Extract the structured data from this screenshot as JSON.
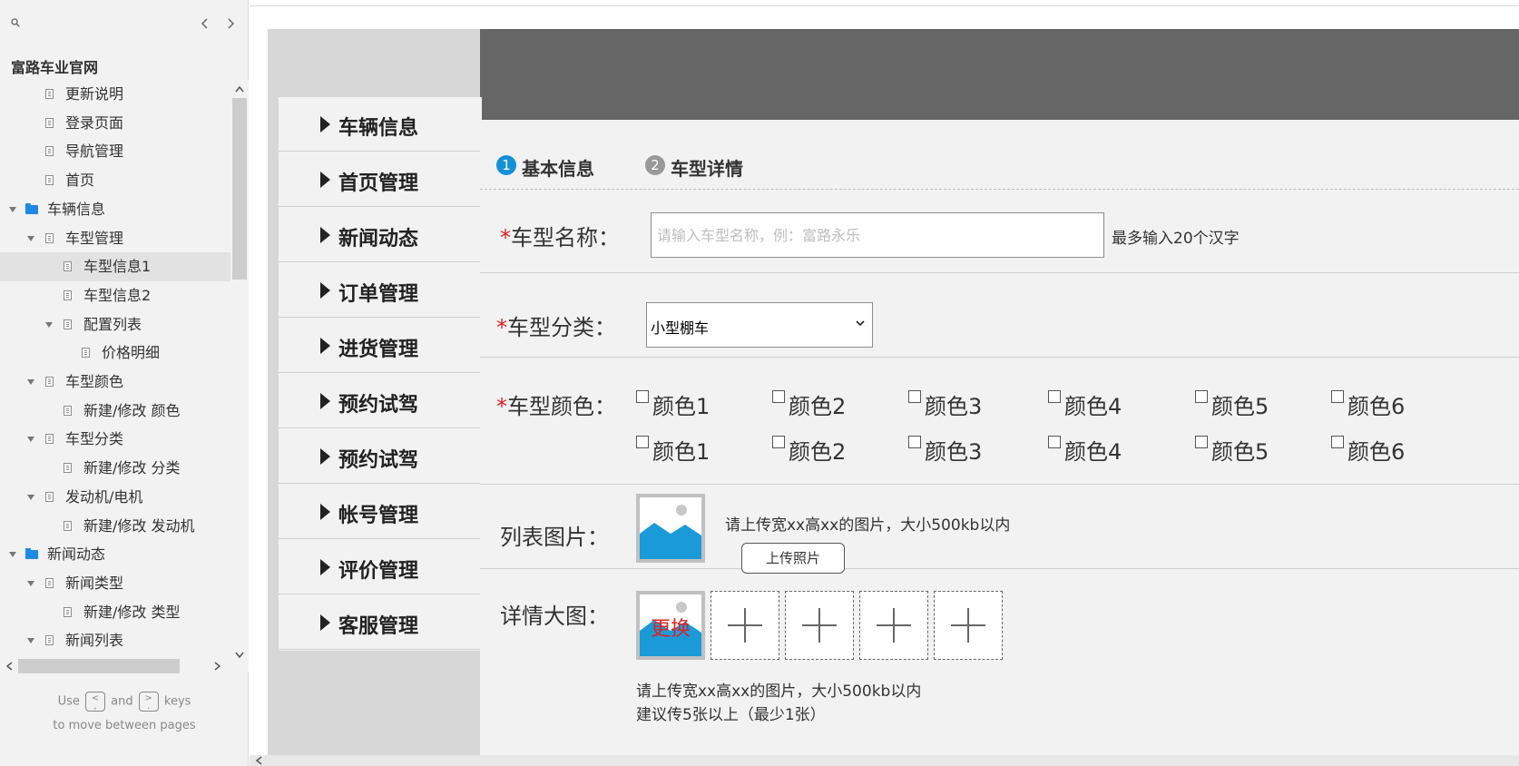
{
  "sidebar": {
    "project_title": "富路车业官网",
    "items": [
      {
        "label": "更新说明",
        "level": 1,
        "type": "page"
      },
      {
        "label": "登录页面",
        "level": 1,
        "type": "page"
      },
      {
        "label": "导航管理",
        "level": 1,
        "type": "page"
      },
      {
        "label": "首页",
        "level": 1,
        "type": "page"
      },
      {
        "label": "车辆信息",
        "level": 0,
        "type": "folder"
      },
      {
        "label": "车型管理",
        "level": 1,
        "type": "page-parent"
      },
      {
        "label": "车型信息1",
        "level": 2,
        "type": "page",
        "selected": true
      },
      {
        "label": "车型信息2",
        "level": 2,
        "type": "page"
      },
      {
        "label": "配置列表",
        "level": 2,
        "type": "page-parent"
      },
      {
        "label": "价格明细",
        "level": 3,
        "type": "page"
      },
      {
        "label": "车型颜色",
        "level": 1,
        "type": "page-parent"
      },
      {
        "label": "新建/修改 颜色",
        "level": 2,
        "type": "page"
      },
      {
        "label": "车型分类",
        "level": 1,
        "type": "page-parent"
      },
      {
        "label": "新建/修改 分类",
        "level": 2,
        "type": "page"
      },
      {
        "label": "发动机/电机",
        "level": 1,
        "type": "page-parent"
      },
      {
        "label": "新建/修改 发动机",
        "level": 2,
        "type": "page"
      },
      {
        "label": "新闻动态",
        "level": 0,
        "type": "folder"
      },
      {
        "label": "新闻类型",
        "level": 1,
        "type": "page-parent"
      },
      {
        "label": "新建/修改 类型",
        "level": 2,
        "type": "page"
      },
      {
        "label": "新闻列表",
        "level": 1,
        "type": "page-parent"
      }
    ],
    "hint": {
      "use": "Use",
      "key_prev": "<\n,",
      "and": "and",
      "key_next": ">\n.",
      "keys": "keys",
      "line2": "to move between pages"
    }
  },
  "menu": {
    "items": [
      "车辆信息",
      "首页管理",
      "新闻动态",
      "订单管理",
      "进货管理",
      "预约试驾",
      "预约试驾",
      "帐号管理",
      "评价管理",
      "客服管理"
    ]
  },
  "steps": [
    {
      "num": "1",
      "label": "基本信息",
      "active": true
    },
    {
      "num": "2",
      "label": "车型详情",
      "active": false
    }
  ],
  "form": {
    "required_mark": "*",
    "name": {
      "label": "车型名称：",
      "placeholder": "请输入车型名称，例：富路永乐",
      "hint": "最多输入20个汉字"
    },
    "category": {
      "label": "车型分类：",
      "selected": "小型棚车"
    },
    "color": {
      "label": "车型颜色：",
      "options": [
        "颜色1",
        "颜色2",
        "颜色3",
        "颜色4",
        "颜色5",
        "颜色6",
        "颜色1",
        "颜色2",
        "颜色3",
        "颜色4",
        "颜色5",
        "颜色6"
      ]
    },
    "list_image": {
      "label": "列表图片：",
      "hint": "请上传宽xx高xx的图片，大小500kb以内",
      "upload_label": "上传照片"
    },
    "detail_image": {
      "label": "详情大图：",
      "replace_label": "更换",
      "hint_line1": "请上传宽xx高xx的图片，大小500kb以内",
      "hint_line2": "建议传5张以上（最少1张）"
    }
  },
  "colors": {
    "accent": "#1590d8",
    "required": "#e02020",
    "header_band": "#666666",
    "folder": "#1e88e5"
  }
}
